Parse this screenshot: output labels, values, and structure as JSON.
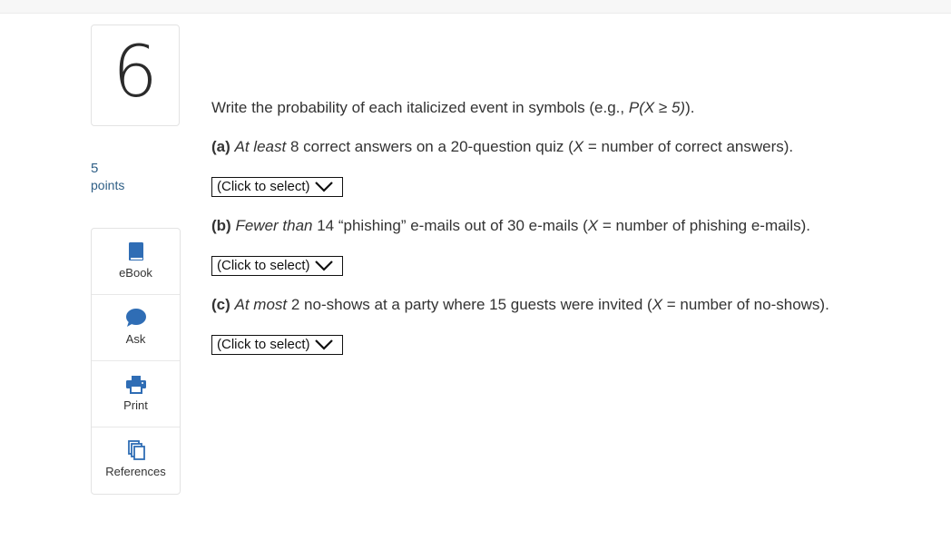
{
  "question": {
    "number": "6",
    "points_value": "5",
    "points_label": "points"
  },
  "tools": [
    {
      "label": "eBook",
      "icon": "ebook-icon"
    },
    {
      "label": "Ask",
      "icon": "chat-bubble-icon"
    },
    {
      "label": "Print",
      "icon": "printer-icon"
    },
    {
      "label": "References",
      "icon": "documents-icon"
    }
  ],
  "prompt": {
    "text_before": "Write the probability of each italicized event in symbols (e.g., ",
    "example": "P(X ≥ 5)",
    "text_after": ")."
  },
  "parts": [
    {
      "letter": "(a)",
      "italic": "At least",
      "text": " 8 correct answers on a 20-question quiz (",
      "var": "X",
      "tail": " = number of correct answers).",
      "select_value": "(Click to select)"
    },
    {
      "letter": "(b)",
      "italic": "Fewer than",
      "text": " 14 “phishing” e-mails out of 30 e-mails (",
      "var": "X",
      "tail": " = number of phishing e-mails).",
      "select_value": "(Click to select)"
    },
    {
      "letter": "(c)",
      "italic": "At most",
      "text": " 2 no-shows at a party where 15 guests were invited (",
      "var": "X",
      "tail": " = number of no-shows).",
      "select_value": "(Click to select)"
    }
  ],
  "colors": {
    "accent": "#2f6db5",
    "points": "#2f5f86"
  }
}
